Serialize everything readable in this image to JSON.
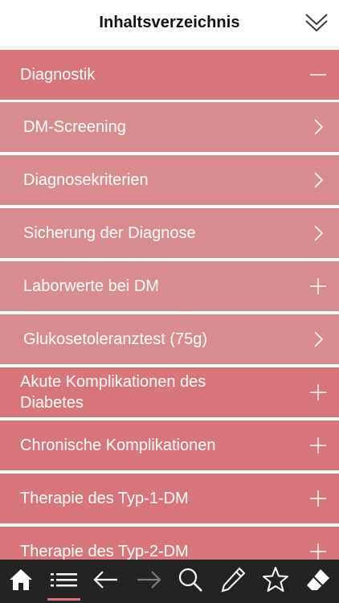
{
  "header": {
    "title": "Inhaltsverzeichnis",
    "collapse_icon": "double-chevron-down-icon"
  },
  "colors": {
    "section_bg": "#d9767c",
    "subitem_bg": "#d98c8f",
    "tabbar_bg": "#232323",
    "active_tab_accent": "#d9767c"
  },
  "items": [
    {
      "label": "Diagnostik",
      "level": "section",
      "accessory": "minus-icon"
    },
    {
      "label": "DM-Screening",
      "level": "sub",
      "accessory": "chevron-right-icon"
    },
    {
      "label": "Diagnosekriterien",
      "level": "sub",
      "accessory": "chevron-right-icon"
    },
    {
      "label": "Sicherung der Diagnose",
      "level": "sub",
      "accessory": "chevron-right-icon"
    },
    {
      "label": "Laborwerte bei DM",
      "level": "sub",
      "accessory": "plus-icon"
    },
    {
      "label": "Glukosetoleranztest (75g)",
      "level": "sub",
      "accessory": "chevron-right-icon"
    },
    {
      "label": "Akute Komplikationen des Diabetes",
      "level": "section",
      "accessory": "plus-icon"
    },
    {
      "label": "Chronische Komplikationen",
      "level": "section",
      "accessory": "plus-icon"
    },
    {
      "label": "Therapie des Typ-1-DM",
      "level": "section",
      "accessory": "plus-icon"
    },
    {
      "label": "Therapie des Typ-2-DM",
      "level": "section",
      "accessory": "plus-icon"
    }
  ],
  "tabbar": {
    "tabs": [
      {
        "icon": "home-icon",
        "active": false
      },
      {
        "icon": "list-icon",
        "active": true
      },
      {
        "icon": "back-arrow-icon",
        "active": false
      },
      {
        "icon": "forward-arrow-icon",
        "active": false,
        "disabled": true
      },
      {
        "icon": "search-icon",
        "active": false
      },
      {
        "icon": "pencil-icon",
        "active": false
      },
      {
        "icon": "star-icon",
        "active": false
      },
      {
        "icon": "eraser-icon",
        "active": false
      }
    ]
  }
}
